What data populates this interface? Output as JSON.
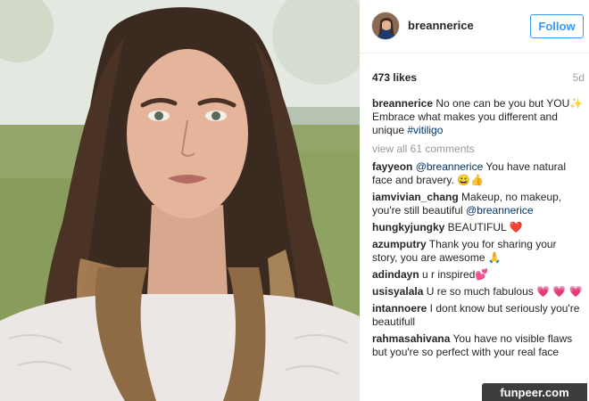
{
  "post": {
    "photo_icon": "selfie-photo",
    "header": {
      "avatar_icon": "profile-avatar",
      "username": "breannerice",
      "follow_label": "Follow"
    },
    "stats": {
      "likes": "473 likes",
      "time": "5d"
    },
    "caption": {
      "user": "breannerice",
      "text_1": " No one can be you but YOU✨ Embrace what makes you different and unique ",
      "hashtag": "#vitiligo"
    },
    "view_all": "view all 61 comments",
    "comments": [
      {
        "user": "fayyeon",
        "mention": "@breannerice",
        "text": " You have natural face and bravery. 😀👍"
      },
      {
        "user": "iamvivian_chang",
        "text": " Makeup, no makeup, you're still beautiful ",
        "mention": "@breannerice"
      },
      {
        "user": "hungkyjungky",
        "text": " BEAUTIFUL ❤️"
      },
      {
        "user": "azumputry",
        "text": " Thank you for sharing your story, you are awesome 🙏"
      },
      {
        "user": "adindayn",
        "text": " u r inspired💕"
      },
      {
        "user": "usisyalala",
        "text": " U re so much fabulous 💗 💗 💗"
      },
      {
        "user": "intannoere",
        "text": " I dont know but seriously you're beautifull"
      },
      {
        "user": "rahmasahivana",
        "text": " You have no visible flaws but you're so perfect with your real face"
      }
    ]
  },
  "watermark": "funpeer.com",
  "colors": {
    "accent": "#3897f0",
    "link": "#003569",
    "muted": "#999999"
  }
}
